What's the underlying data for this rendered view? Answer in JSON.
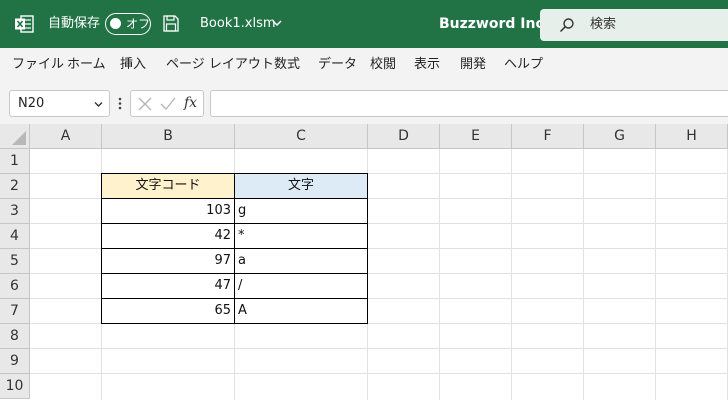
{
  "titlebar": {
    "autosave_label": "自動保存",
    "autosave_state": "オフ",
    "filename": "Book1.xlsm",
    "company": "Buzzword Inc.",
    "search_placeholder": "検索",
    "bg_color": "#217346"
  },
  "menu": [
    {
      "label": "ファイル"
    },
    {
      "label": "ホーム"
    },
    {
      "label": "挿入"
    },
    {
      "label": "ページ レイアウト"
    },
    {
      "label": "数式"
    },
    {
      "label": "データ"
    },
    {
      "label": "校閲"
    },
    {
      "label": "表示"
    },
    {
      "label": "開発"
    },
    {
      "label": "ヘルプ"
    }
  ],
  "formula_bar": {
    "name_box": "N20",
    "fx_label": "fx",
    "formula": ""
  },
  "sheet": {
    "columns": [
      "A",
      "B",
      "C",
      "D",
      "E",
      "F",
      "G",
      "H"
    ],
    "rows": [
      "1",
      "2",
      "3",
      "4",
      "5",
      "6",
      "7",
      "8",
      "9",
      "10"
    ],
    "table": {
      "header_b": "文字コード",
      "header_c": "文字",
      "header_b_color": "#fff2cc",
      "header_c_color": "#ddebf7",
      "rows": [
        {
          "code": "103",
          "char": "g"
        },
        {
          "code": "42",
          "char": "*"
        },
        {
          "code": "97",
          "char": "a"
        },
        {
          "code": "47",
          "char": "/"
        },
        {
          "code": "65",
          "char": "A"
        }
      ]
    }
  }
}
